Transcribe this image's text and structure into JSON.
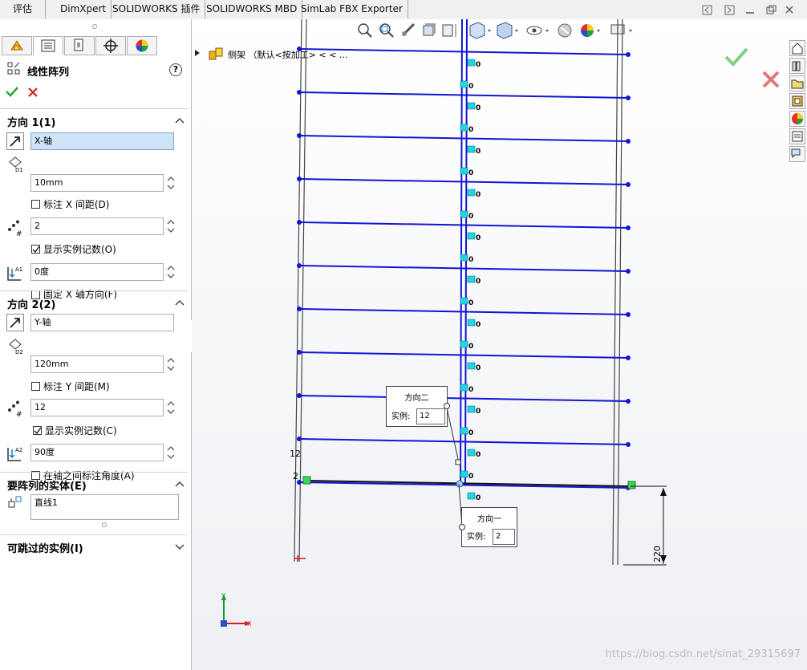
{
  "tabs": [
    "评估",
    "DimXpert",
    "SOLIDWORKS 插件",
    "SOLIDWORKS MBD",
    "SimLab FBX Exporter"
  ],
  "panel": {
    "title": "线性阵列",
    "help": "?",
    "direction1": {
      "title": "方向 1(1)",
      "axis": "X-轴",
      "spacing": "10mm",
      "dim_label": "标注 X 间距(D)",
      "count": "2",
      "show_count_label": "显示实例记数(O)",
      "angle": "0度",
      "fix_label": "固定 X 轴方向(F)"
    },
    "direction2": {
      "title": "方向 2(2)",
      "axis": "Y-轴",
      "spacing": "120mm",
      "dim_label": "标注 Y 间距(M)",
      "count": "12",
      "show_count_label": "显示实例记数(C)",
      "angle": "90度",
      "angle_dim_label": "在轴之间标注角度(A)"
    },
    "entities": {
      "title": "要阵列的实体(E)",
      "value": "直线1"
    },
    "skip": {
      "title": "可跳过的实例(I)"
    }
  },
  "viewport": {
    "tree_label": "侧架 （默认<按加工> < < ...",
    "popup_dir2": {
      "title": "方向二",
      "label": "实例:",
      "value": "12"
    },
    "popup_dir1": {
      "title": "方向一",
      "label": "实例:",
      "value": "2"
    },
    "dim_220": "220",
    "dim_12": "12",
    "dim_2": "2",
    "marker_zero": "0",
    "axis_y": "Y",
    "axis_x": "X",
    "watermark": "https://blog.csdn.net/sinat_29315697"
  },
  "colors": {
    "pattern_line": "#1414d2",
    "marker": "#22d4e6",
    "confirm": "#2aa82a",
    "cancel": "#d02020"
  }
}
